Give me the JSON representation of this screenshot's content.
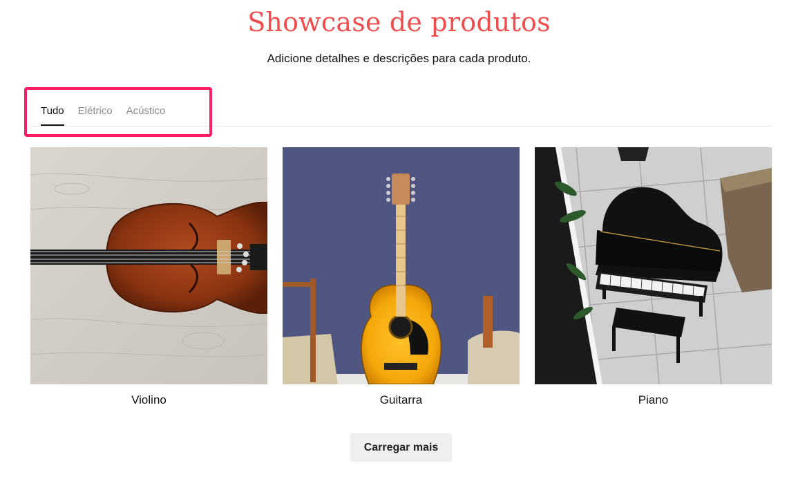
{
  "header": {
    "title": "Showcase de produtos",
    "subtitle": "Adicione detalhes e descrições para cada produto."
  },
  "tabs": [
    {
      "label": "Tudo",
      "active": true
    },
    {
      "label": "Elétrico",
      "active": false
    },
    {
      "label": "Acústico",
      "active": false
    }
  ],
  "products": [
    {
      "name": "Violino",
      "image": "violin-on-wood-image"
    },
    {
      "name": "Guitarra",
      "image": "acoustic-guitar-against-blue-wall-image"
    },
    {
      "name": "Piano",
      "image": "grand-piano-on-tile-floor-image"
    }
  ],
  "actions": {
    "load_more_label": "Carregar mais"
  },
  "colors": {
    "title": "#f04e4e",
    "highlight": "#ff1e63",
    "active_tab": "#111111",
    "inactive_tab": "#8a8a8a",
    "button_bg": "#efefef"
  }
}
